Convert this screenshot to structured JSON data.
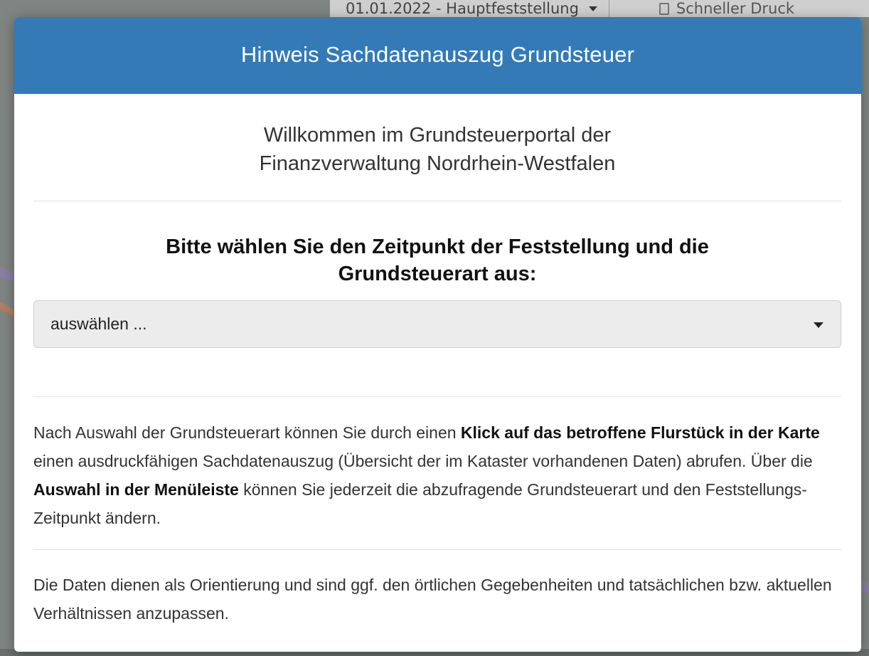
{
  "topbar": {
    "date_select": "01.01.2022 - Hauptfeststellung",
    "print_label": "Schneller Druck"
  },
  "modal": {
    "title": "Hinweis Sachdatenauszug Grundsteuer",
    "welcome_line1": "Willkommen im Grundsteuerportal der",
    "welcome_line2": "Finanzverwaltung Nordrhein-Westfalen",
    "prompt_line1": "Bitte wählen Sie den Zeitpunkt der Feststellung und die",
    "prompt_line2": "Grundsteuerart aus:",
    "select": {
      "selected": "auswählen ..."
    },
    "info": {
      "part1": "Nach Auswahl der Grundsteuerart können Sie durch einen ",
      "bold1": "Klick auf das betroffene Flurstück in der Karte",
      "part2": " einen ausdruckfähigen Sachdatenauszug (Übersicht der im Kataster vorhandenen Daten) abrufen. Über die ",
      "bold2": "Auswahl in der Menüleiste",
      "part3": " können Sie jederzeit die abzufragende Grundsteuerart und den Feststellungs-Zeitpunkt ändern."
    },
    "note": "Die Daten dienen als Orientierung und sind ggf. den örtlichen Gegebenheiten und tatsächlichen bzw. aktuellen Verhältnissen anzupassen."
  },
  "colors": {
    "header": "#337ab7",
    "select_bg": "#ececec"
  }
}
